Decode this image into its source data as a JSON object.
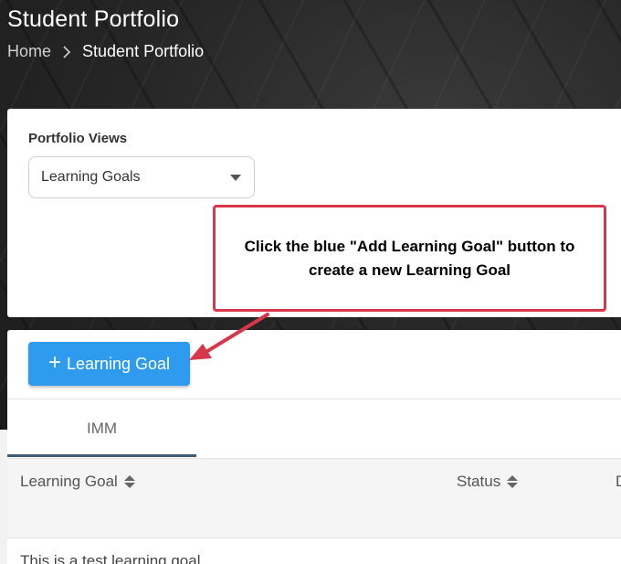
{
  "header": {
    "title": "Student Portfolio",
    "breadcrumb": {
      "home": "Home",
      "current": "Student Portfolio"
    }
  },
  "portfolio_views": {
    "label": "Portfolio Views",
    "selected": "Learning Goals"
  },
  "callout": {
    "text": "Click the blue \"Add Learning Goal\" button to create a new Learning Goal",
    "border_color": "#d6384a"
  },
  "toolbar": {
    "add_button_label": "Learning Goal",
    "add_button_color": "#2e9bee"
  },
  "tabs": [
    {
      "label": "IMM",
      "active": true
    }
  ],
  "table": {
    "columns": [
      "Learning Goal",
      "Status",
      "D"
    ],
    "rows": [
      {
        "learning_goal": "This is a test learning goal"
      }
    ]
  },
  "icons": {
    "breadcrumb_separator": "chevron-right-icon",
    "select_caret": "caret-down-icon",
    "add": "plus-icon",
    "sort": "sort-icon"
  }
}
